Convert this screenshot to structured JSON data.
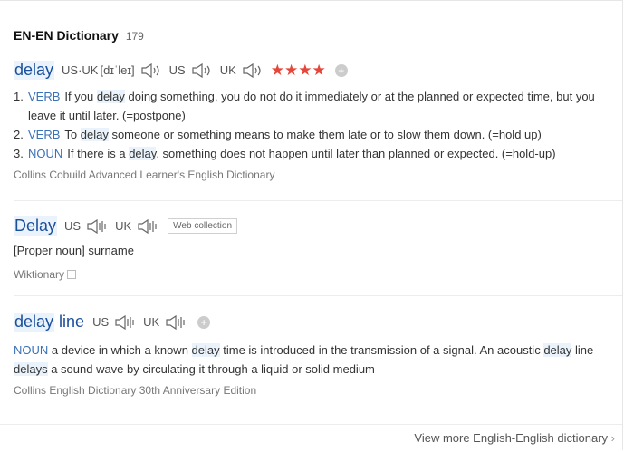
{
  "header": {
    "title": "EN-EN Dictionary",
    "count": "179"
  },
  "entries": [
    {
      "word": "delay",
      "phonetic_label": "US·UK",
      "phonetic": "[dɪˈleɪ]",
      "us": "US",
      "uk": "UK",
      "stars": "★★★★",
      "plus": "+",
      "defs": [
        {
          "num": "1.",
          "pos": "VERB",
          "pre": "If you ",
          "hl": "delay",
          "post": " doing something, you do not do it immediately or at the planned or expected time, but you leave it until later. (=postpone)"
        },
        {
          "num": "2.",
          "pos": "VERB",
          "pre": "To ",
          "hl": "delay",
          "post": " someone or something means to make them late or to slow them down. (=hold up)"
        },
        {
          "num": "3.",
          "pos": "NOUN",
          "pre": "If there is a ",
          "hl": "delay",
          "post": ", something does not happen until later than planned or expected. (=hold-up)"
        }
      ],
      "source": "Collins Cobuild Advanced Learner's English Dictionary"
    },
    {
      "word": "Delay",
      "us": "US",
      "uk": "UK",
      "tag": "Web collection",
      "body": "[Proper noun] surname",
      "source": "Wiktionary"
    },
    {
      "word_a": "delay",
      "word_b": "line",
      "us": "US",
      "uk": "UK",
      "plus": "+",
      "pos": "NOUN",
      "t1": " a device in which a known ",
      "h1": "delay",
      "t2": " time is introduced in the transmission of a signal. An acoustic ",
      "h2": "delay",
      "t3": " line ",
      "h3": "delays",
      "t4": " a sound wave by circulating it through a liquid or solid medium",
      "source": "Collins English Dictionary 30th Anniversary Edition"
    }
  ],
  "footer": {
    "more": "View more English-English dictionary",
    "chevron": "›"
  }
}
